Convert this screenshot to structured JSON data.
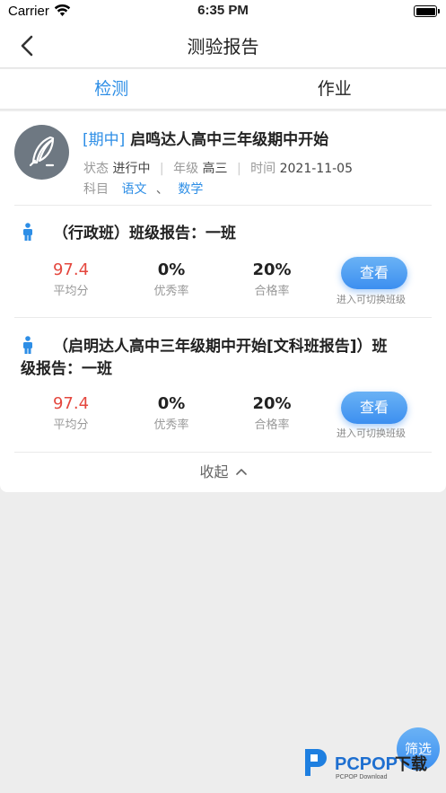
{
  "status_bar": {
    "carrier": "Carrier",
    "time": "6:35 PM"
  },
  "nav": {
    "title": "测验报告"
  },
  "tabs": [
    {
      "label": "检测",
      "active": true
    },
    {
      "label": "作业",
      "active": false
    }
  ],
  "exam": {
    "tag": "[期中]",
    "name": "启鸣达人高中三年级期中开始",
    "status_label": "状态",
    "status_value": "进行中",
    "grade_label": "年级",
    "grade_value": "高三",
    "time_label": "时间",
    "time_value": "2021-11-05",
    "subject_label": "科目",
    "subjects": [
      "语文",
      "数学"
    ],
    "subject_sep": "、"
  },
  "reports": [
    {
      "title": "（行政班）班级报告：一班",
      "stats": [
        {
          "value": "97.4",
          "label": "平均分"
        },
        {
          "value": "0%",
          "label": "优秀率"
        },
        {
          "value": "20%",
          "label": "合格率"
        }
      ],
      "button_label": "查看",
      "hint": "进入可切换班级"
    },
    {
      "title_line1": "（启明达人高中三年级期中开始[文科班报告]）班",
      "title_line2": "级报告：一班",
      "stats": [
        {
          "value": "97.4",
          "label": "平均分"
        },
        {
          "value": "0%",
          "label": "优秀率"
        },
        {
          "value": "20%",
          "label": "合格率"
        }
      ],
      "button_label": "查看",
      "hint": "进入可切换班级"
    }
  ],
  "collapse_label": "收起",
  "filter_label": "筛选",
  "watermark": {
    "brand": "PCPOP",
    "suffix": "下载",
    "sub": "PCPOP Download"
  },
  "colors": {
    "accent": "#2d8ee6",
    "highlight_red": "#e4473e",
    "button_gradient_top": "#6ab2f5",
    "button_gradient_bottom": "#3c8ff0"
  },
  "icons": [
    "back-arrow-icon",
    "wifi-icon",
    "battery-icon",
    "quill-icon",
    "person-icon",
    "chevron-up-icon"
  ]
}
